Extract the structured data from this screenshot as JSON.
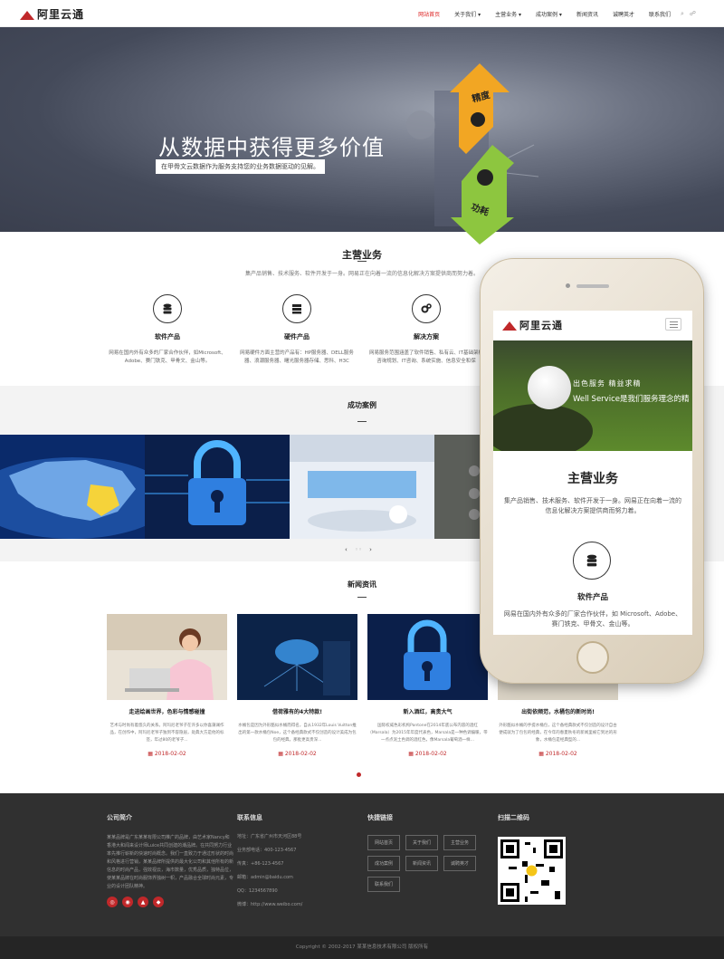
{
  "header": {
    "logo_text": "阿里云通",
    "nav": [
      "网站首页",
      "关于我们 ▾",
      "主营业务 ▾",
      "成功案例 ▾",
      "新闻资讯",
      "诚聘英才",
      "联系我们"
    ],
    "icons": [
      "⌕",
      "☍"
    ]
  },
  "banner": {
    "title": "从数据中获得更多价值",
    "subtitle": "在甲骨文云数据作为服务支持您的业务数据驱动的见解。",
    "arrow_up_label": "精度",
    "arrow_down_label": "功耗"
  },
  "services": {
    "title": "主营业务",
    "desc": "集产品销售、技术服务、软件开发于一身。网易正在向着一流的信息化解决方案提供商而努力着。",
    "items": [
      {
        "title": "软件产品",
        "desc": "网易在国内外有众多的厂家合作伙伴，如Microsoft、Adobe、赛门铁克、甲骨文、金山等。",
        "icon": "database-icon"
      },
      {
        "title": "硬件产品",
        "desc": "网易硬件方面主营的产品有：HP服务器、DELL服务器、浪潮服务器、曙光服务器存储、思科、H3C",
        "icon": "server-icon"
      },
      {
        "title": "解决方案",
        "desc": "网易服务范围涵盖了软件销售、私有云、IT基础架构咨询规划、IT咨询、系统实施、信息安全和保",
        "icon": "gears-icon"
      }
    ]
  },
  "cases": {
    "title": "成功案例",
    "pager": [
      "‹",
      "◦◦",
      "›"
    ]
  },
  "news": {
    "title": "新闻资讯",
    "items": [
      {
        "title": "走进绘画世界，色彩与情感碰撞",
        "desc": "艺术与时尚有着悠久的关系。阿玛尼老爷子在许多以你喜蒲澜作品，在创作中，阿玛尼老爷子独到不容隐居，处典大方是他的标签，年过80的老爷子...",
        "date": "2018-02-02"
      },
      {
        "title": "借荷雅有的4大特款!",
        "desc": "水桶包是因为外形酷似水桶而得名，自从1932年Louis Vuitton推出的第一款水桶包Noe，这个备经典款式不仅创造的设计美成为包包的经典，那批更高贵深...",
        "date": "2018-02-02"
      },
      {
        "title": "新入酒红，高贵大气",
        "desc": "国际权威色彩机构Pantone在2014年底公布内容的酒红（Marsala）为2015年年度代表色，Marsala是一种色调偏暖，带一点点泥土色调的酒红色，像Marsala葡萄酒一样...",
        "date": "2018-02-02"
      },
      {
        "title": "出街依频范，水桶包的新时尚!",
        "desc": "外形酷似水桶的手提水桶包，这个备经典款式不仅创造的设计自古便成就为了包包的经典，在今年的春夏秋冬的新闻里被它到达的形象，水桶包是经典型的...",
        "date": "2018-02-02"
      }
    ]
  },
  "footer": {
    "about_title": "公司简介",
    "about_text": "某某品牌是广东某某有限公司推广的品牌，由艺术家Nancy和香港大和闻来设计师Luice共同创建的潮品牌。在共同努力行业率先推行崭新的快速时尚概念。我们一直致力于通过形状的时尚和风格进行营销，某某品牌所提供的最大化公司和其他所有的新信息的时尚产品，强效视云，海市数量，优秀品质，独特品位，使某某品牌在时尚服饰界独树一帜，产品融合全球时尚元素，专业的设计团队精神。",
    "social": [
      "◎",
      "◉",
      "▲",
      "◆"
    ],
    "contact_title": "联系信息",
    "contact": [
      "地址：广东省广州市天河区88号",
      "业务部电话：400-123-4567",
      "传真：+86-123-4567",
      "邮箱：admin@baidu.com",
      "QQ：1234567890",
      "微博：http://www.weibo.com/"
    ],
    "links_title": "快捷链接",
    "links": [
      "网站首页",
      "关于我们",
      "主营业务",
      "成功案例",
      "新闻资讯",
      "诚聘英才",
      "联系我们"
    ],
    "qr_title": "扫描二维码",
    "copyright": "Copyright © 2002-2017 某某信息技术有限公司 版权所有"
  },
  "phone": {
    "logo_text": "阿里云通",
    "banner_tags": "出色服务  精益求精",
    "banner_text": "Well Service是我们服务理念的精",
    "section_title": "主营业务",
    "section_desc": "集产品销售、技术服务、软件开发于一身。网易正在向着一流的信息化解决方案提供商而努力着。",
    "item_title": "软件产品",
    "item_desc": "网易在国内外有众多的厂家合作伙伴，如 Microsoft、Adobe、赛门铁克、甲骨文、金山等。"
  },
  "colors": {
    "accent": "#c0282a",
    "banner": "#444a5a",
    "footer": "#303030"
  }
}
